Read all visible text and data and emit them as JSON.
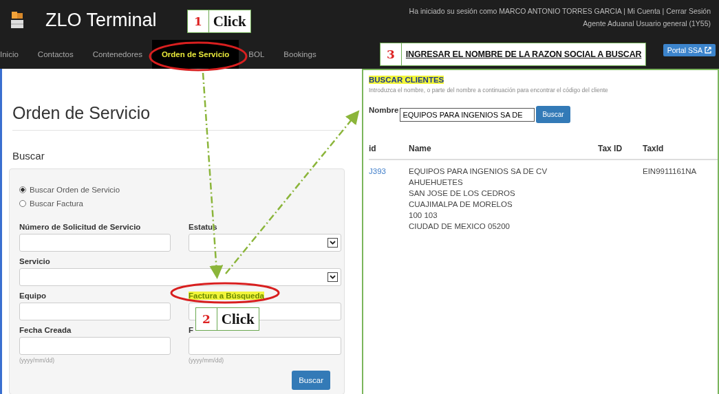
{
  "header": {
    "title": "ZLO Terminal",
    "user_line": "Ha iniciado su sesión como MARCO ANTONIO TORRES GARCIA | Mi Cuenta | Cerrar Sesión",
    "role_line": "Agente Aduanal Usuario general (1Y55)",
    "portal_button": "Portal SSA"
  },
  "nav": [
    {
      "label": "Inicio",
      "selected": false
    },
    {
      "label": "Contactos",
      "selected": false
    },
    {
      "label": "Contenedores",
      "selected": false
    },
    {
      "label": "Orden de Servicio",
      "selected": true
    },
    {
      "label": "BOL",
      "selected": false
    },
    {
      "label": "Bookings",
      "selected": false
    }
  ],
  "left": {
    "heading": "Orden de Servicio",
    "section": "Buscar",
    "radios": [
      {
        "label": "Buscar Orden de Servicio",
        "selected": true
      },
      {
        "label": "Buscar Factura",
        "selected": false
      }
    ],
    "fields": [
      {
        "label": "Número de Solicitud de Servicio",
        "kind": "input"
      },
      {
        "label": "Estatus",
        "kind": "select"
      },
      {
        "label": "Servicio",
        "kind": "select_wide"
      },
      {
        "label": "Equipo",
        "kind": "input"
      },
      {
        "label": "Factura a Búsqueda",
        "kind": "link"
      },
      {
        "label": "Fecha Creada",
        "kind": "date",
        "hint": "(yyyy/mm/dd)"
      },
      {
        "label": "F",
        "kind": "date",
        "hint": "(yyyy/mm/dd)"
      }
    ],
    "button": "Buscar"
  },
  "right": {
    "title": "BUSCAR CLIENTES",
    "description": "Introduzca el nombre, o parte del nombre a continuación para encontrar el código del cliente",
    "name_label": "Nombre",
    "name_value": "EQUIPOS PARA INGENIOS SA DE",
    "button": "Buscar",
    "columns": [
      "id",
      "Name",
      "Tax ID",
      "TaxId"
    ],
    "rows": [
      {
        "id": "J393",
        "name_lines": [
          "EQUIPOS PARA INGENIOS SA DE CV",
          "AHUEHUETES",
          "SAN JOSE DE LOS CEDROS",
          "CUAJIMALPA DE MORELOS",
          "100 103",
          "CIUDAD DE MEXICO 05200"
        ],
        "tax_id_2": "EIN9911161NA"
      }
    ]
  },
  "callouts": [
    {
      "number": "1",
      "text": "Click"
    },
    {
      "number": "2",
      "text": "Click"
    },
    {
      "number": "3",
      "text": "INGRESAR EL NOMBRE DE LA RAZON SOCIAL A BUSCAR"
    }
  ]
}
